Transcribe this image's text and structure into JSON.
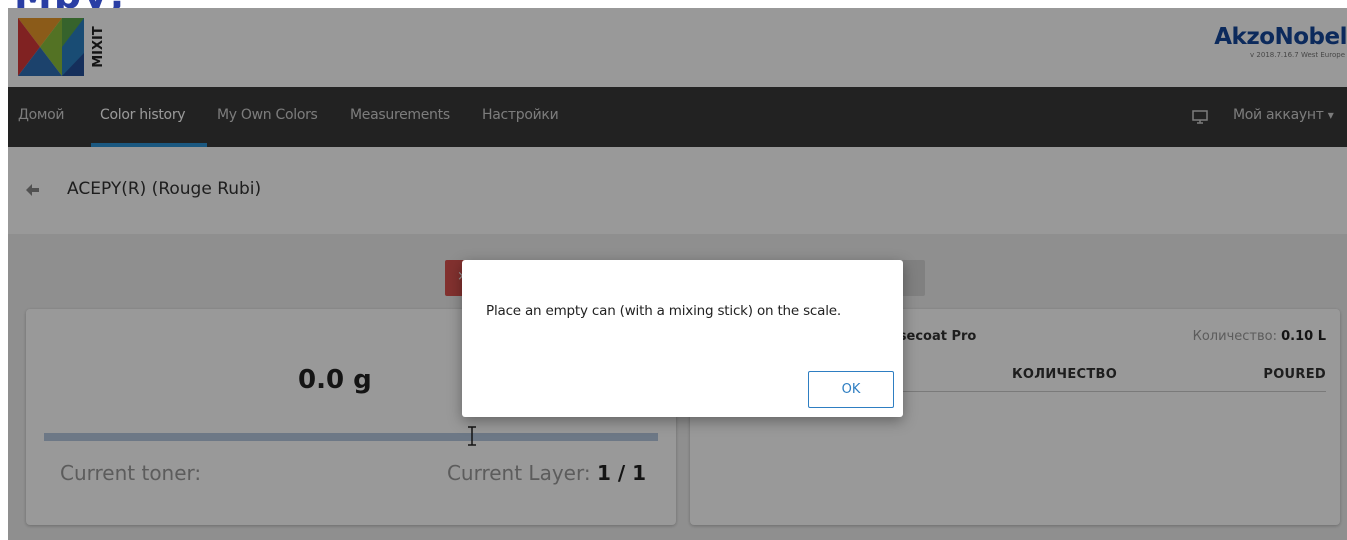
{
  "top_strip": {
    "text": "Мру,"
  },
  "header": {
    "logo_label": "MIXIT",
    "brand_name": "AkzoNobel",
    "version": "v 2018.7.16.7 West Europe"
  },
  "nav": {
    "items": [
      {
        "label": "Домой"
      },
      {
        "label": "Color history"
      },
      {
        "label": "My Own Colors"
      },
      {
        "label": "Measurements"
      },
      {
        "label": "Настройки"
      }
    ],
    "account_label": "Мой аккаунт",
    "account_caret": "▾"
  },
  "breadcrumb": {
    "title": "ACEPY(R) (Rouge Rubi)"
  },
  "actions": {
    "red_button_label": "×"
  },
  "scale_card": {
    "weight": "0.0 g",
    "current_toner_label": "Current toner:",
    "current_layer_label": "Current Layer:",
    "current_layer_value": "1 / 1"
  },
  "recipe_card": {
    "product_name": "asecoat Pro",
    "quantity_label": "Количество:",
    "quantity_value": "0.10 L",
    "columns": {
      "quantity": "КОЛИЧЕСТВО",
      "poured": "POURED"
    }
  },
  "modal": {
    "message": "Place an empty can (with a mixing stick) on the scale.",
    "ok_label": "OK"
  },
  "colors": {
    "nav_bg": "#3a3a3a",
    "accent": "#2e93d6",
    "brand": "#14469a",
    "danger": "#d9534f"
  },
  "icons": [
    "mixit-logo",
    "monitor-icon",
    "back-arrow-icon",
    "text-cursor-icon",
    "chevron-down-icon"
  ]
}
